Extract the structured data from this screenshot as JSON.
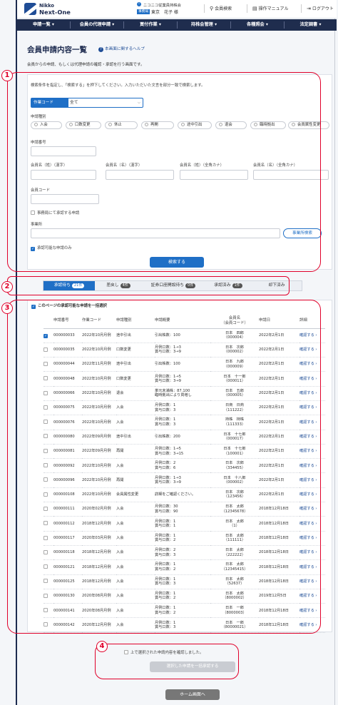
{
  "header": {
    "brand_line1": "Nikko",
    "brand_line2": "Next-One",
    "info_icon": "i",
    "association": "ニコニコ従業員持株会",
    "role_badge": "事務局",
    "user_name": "東京　花子 様",
    "member_search": "会員検索",
    "manual": "操作マニュアル",
    "logout": "ログアウト"
  },
  "nav": [
    "申請一覧 ▾",
    "会員の代理申請 ▾",
    "買付作業 ▾",
    "持株会管理 ▾",
    "各種照会 ▾",
    "法定調書 ▾"
  ],
  "page": {
    "title": "会員申請内容一覧",
    "help": "本画面に関するヘルプ",
    "description": "会員からの申請、もしくは代理申請の確認・承認を行う画面です。"
  },
  "search": {
    "instruction": "検索条件を指定し、「検索する」を押下してください。入力いただいた文言を部分一致で検索します。",
    "work_code_label": "作業コード",
    "work_code_value": "全て",
    "app_type_label": "申請種別",
    "app_types": [
      "入会",
      "口数変更",
      "休止",
      "再開",
      "途中引出",
      "退会",
      "臨時拠出",
      "会員属性変更"
    ],
    "app_no_label": "申請番号",
    "name_labels": [
      "会員名（姓）（漢字）",
      "会員名（名）（漢字）",
      "会員名（姓）（全角カナ）",
      "会員名（名）（全角カナ）"
    ],
    "member_code_label": "会員コード",
    "office_approve_label": "事務局にて承認する申請",
    "office_label": "事業所",
    "office_search_btn": "事業所検索",
    "approvable_only_label": "承認可能な申請のみ",
    "search_btn": "検索する"
  },
  "tabs": [
    {
      "label": "承認待ち",
      "count": "21件"
    },
    {
      "label": "差戻し",
      "count": "4件"
    },
    {
      "label": "証券口座開設待ち",
      "count": "0件"
    },
    {
      "label": "承認済み",
      "count": "1件"
    },
    {
      "label": "却下済み",
      "count": ""
    }
  ],
  "bulk_select_label": "このページの承認可能な申請を一括選択",
  "table": {
    "headers": [
      "申請番号",
      "作業コード",
      "申請種別",
      "申請概要",
      "会員名\n（会員コード）",
      "申請日",
      "詳細"
    ],
    "rows": [
      {
        "checked": true,
        "no": "000000033",
        "code": "2022年10月月例",
        "type": "途中引出",
        "summary": "引出株数：100",
        "member": "日本　四郎\n（000004）",
        "date": "2022年2月1日",
        "link": "確認する ›"
      },
      {
        "checked": false,
        "no": "000000035",
        "code": "2022年10月月例",
        "type": "口数変更",
        "summary": "月例口数：1→3\n賞与口数：3→9",
        "member": "日本　次郎\n（000002）",
        "date": "2022年2月1日",
        "link": "確認する ›"
      },
      {
        "checked": false,
        "no": "000000044",
        "code": "2022年11月月例",
        "type": "途中引出",
        "summary": "引出株数：100",
        "member": "日本　九郎\n（000009）",
        "date": "2022年2月1日",
        "link": "確認する ›"
      },
      {
        "checked": false,
        "no": "000000048",
        "code": "2022年10月月例",
        "type": "口数変更",
        "summary": "月例口数：1→5\n賞与口数：3→9",
        "member": "日本　十一郎\n（000011）",
        "date": "2022年2月1日",
        "link": "確認する ›"
      },
      {
        "checked": false,
        "no": "000000066",
        "code": "2022年10月月例",
        "type": "退会",
        "summary": "単元未満株：87.100\n臨時拠出により買増し",
        "member": "日本　五郎\n（000005）",
        "date": "2022年2月1日",
        "link": "確認する ›"
      },
      {
        "checked": false,
        "no": "000000075",
        "code": "2022年10月月例",
        "type": "入会",
        "summary": "月例口数：1\n賞与口数：3",
        "member": "日商　日商\n（111222）",
        "date": "2022年2月1日",
        "link": "確認する ›"
      },
      {
        "checked": false,
        "no": "000000076",
        "code": "2022年10月月例",
        "type": "入会",
        "summary": "月例口数：1\n賞与口数：3",
        "member": "持株　持株\n（111333）",
        "date": "2022年2月1日",
        "link": "確認する ›"
      },
      {
        "checked": false,
        "no": "000000080",
        "code": "2022年09月月例",
        "type": "途中引出",
        "summary": "引出株数：200",
        "member": "日本　十七郎\n（000017）",
        "date": "2022年2月1日",
        "link": "確認する ›"
      },
      {
        "checked": false,
        "no": "000000081",
        "code": "2022年09月月例",
        "type": "再開",
        "summary": "月例口数：1→5\n賞与口数：3→15",
        "member": "日本　十七郎\n（100001）",
        "date": "2022年2月1日",
        "link": "確認する ›"
      },
      {
        "checked": false,
        "no": "000000092",
        "code": "2022年10月月例",
        "type": "入会",
        "summary": "月例口数：2\n賞与口数：6",
        "member": "日本　次郎\n（334455）",
        "date": "2022年2月1日",
        "link": "確認する ›"
      },
      {
        "checked": false,
        "no": "000000096",
        "code": "2022年10月月例",
        "type": "再開",
        "summary": "月例口数：1→3\n賞与口数：3→9",
        "member": "日本　十八郎\n（000002）",
        "date": "2022年2月1日",
        "link": "確認する ›"
      },
      {
        "checked": false,
        "no": "000000108",
        "code": "2022年10月月例",
        "type": "会員属性変更",
        "summary": "詳細をご確認ください。",
        "member": "日本　次郎\n（123456）",
        "date": "2022年2月1日",
        "link": "確認する ›"
      },
      {
        "checked": false,
        "no": "000000111",
        "code": "2020年02月月例",
        "type": "入会",
        "summary": "月例口数：30\n賞与口数：90",
        "member": "日本　太郎\n（12345678）",
        "date": "2018年12月18日",
        "link": "確認する ›"
      },
      {
        "checked": false,
        "no": "000000112",
        "code": "2018年12月月例",
        "type": "入会",
        "summary": "月例口数：1\n賞与口数：1",
        "member": "日本　太郎\n（1）",
        "date": "2018年12月18日",
        "link": "確認する ›"
      },
      {
        "checked": false,
        "no": "000000117",
        "code": "2020年03月月例",
        "type": "入会",
        "summary": "月例口数：1\n賞与口数：2",
        "member": "日本　太郎\n（111111）",
        "date": "2018年12月18日",
        "link": "確認する ›"
      },
      {
        "checked": false,
        "no": "000000118",
        "code": "2018年12月月例",
        "type": "入会",
        "summary": "月例口数：2\n賞与口数：3",
        "member": "日本　太郎\n（222222）",
        "date": "2018年12月18日",
        "link": "確認する ›"
      },
      {
        "checked": false,
        "no": "000000121",
        "code": "2018年12月月例",
        "type": "入会",
        "summary": "月例口数：1\n賞与口数：2",
        "member": "日本　太郎\n（12345415）",
        "date": "2018年12月18日",
        "link": "確認する ›"
      },
      {
        "checked": false,
        "no": "000000125",
        "code": "2018年12月月例",
        "type": "入会",
        "summary": "月例口数：1\n賞与口数：3",
        "member": "日本　太郎\n（52637）",
        "date": "2018年12月18日",
        "link": "確認する ›"
      },
      {
        "checked": false,
        "no": "000000130",
        "code": "2020年08月月例",
        "type": "入会",
        "summary": "月例口数：1\n賞与口数：2",
        "member": "日本　太郎\n（8000002）",
        "date": "2019年12月5日",
        "link": "確認する ›"
      },
      {
        "checked": false,
        "no": "000000141",
        "code": "2020年08月月例",
        "type": "入会",
        "summary": "月例口数：1\n賞与口数：2",
        "member": "日本　一郎\n（8000003）",
        "date": "2018年12月18日",
        "link": "確認する ›"
      },
      {
        "checked": false,
        "no": "000000142",
        "code": "2020年12月月例",
        "type": "入会",
        "summary": "月例口数：1\n賞与口数：3",
        "member": "日本　一郎\n（80000021）",
        "date": "2018年12月18日",
        "link": "確認する ›"
      }
    ]
  },
  "confirm": {
    "confirm_label": "上で選択された申請内容を確認しました。",
    "bulk_approve_btn": "選択した申請を一括承認する"
  },
  "home_btn": "ホーム画面へ",
  "annotations": [
    "1",
    "2",
    "3",
    "4"
  ],
  "colors": {
    "accent": "#1f6fc6",
    "nav": "#1f2d4e",
    "annotation": "#e0002a"
  }
}
